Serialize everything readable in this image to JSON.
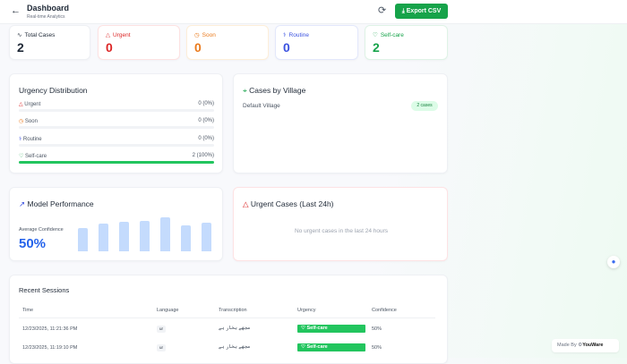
{
  "header": {
    "title": "Dashboard",
    "subtitle": "Real-time Analytics",
    "export_label": "Export CSV"
  },
  "stats": [
    {
      "label": "Total Cases",
      "value": "2",
      "color": "#111827"
    },
    {
      "label": "Urgent",
      "value": "0",
      "color": "#dc2626"
    },
    {
      "label": "Soon",
      "value": "0",
      "color": "#ea7a1c"
    },
    {
      "label": "Routine",
      "value": "0",
      "color": "#3b52e0"
    },
    {
      "label": "Self-care",
      "value": "2",
      "color": "#16a34a"
    }
  ],
  "distribution": {
    "title": "Urgency Distribution",
    "rows": [
      {
        "label": "Urgent",
        "count": "0 (0%)",
        "percent": 0
      },
      {
        "label": "Soon",
        "count": "0 (0%)",
        "percent": 0
      },
      {
        "label": "Routine",
        "count": "0 (0%)",
        "percent": 0
      },
      {
        "label": "Self-care",
        "count": "2 (100%)",
        "percent": 100
      }
    ]
  },
  "villages": {
    "title": "Cases by Village",
    "items": [
      {
        "name": "Default Village",
        "cases": "2 cases"
      }
    ]
  },
  "model": {
    "title": "Model Performance",
    "avg_label": "Average Confidence",
    "avg_value": "50%",
    "bars": [
      65,
      78,
      82,
      85,
      95,
      72,
      80
    ]
  },
  "urgent_cases": {
    "title": "Urgent Cases (Last 24h)",
    "empty": "No urgent cases in the last 24 hours"
  },
  "sessions": {
    "title": "Recent Sessions",
    "columns": [
      "Time",
      "Language",
      "Transcription",
      "Urgency",
      "Confidence"
    ],
    "rows": [
      {
        "time": "12/23/2025, 11:21:36 PM",
        "language": "ur",
        "transcription": "مجھے بخار ہے",
        "urgency": "Self-care",
        "confidence": "50%"
      },
      {
        "time": "12/23/2025, 11:19:10 PM",
        "language": "ur",
        "transcription": "مجھے بخار ہے",
        "urgency": "Self-care",
        "confidence": "50%"
      }
    ]
  },
  "footer": {
    "made_by": "Made By",
    "brand": "YouWare"
  }
}
